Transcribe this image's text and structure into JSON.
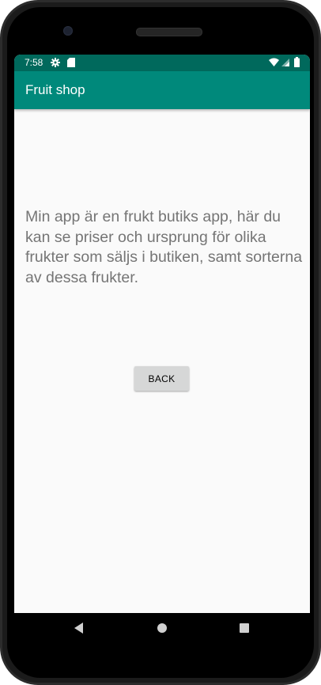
{
  "status_bar": {
    "time": "7:58",
    "icons": [
      "gear-icon",
      "sd-card-icon",
      "wifi-icon",
      "signal-icon",
      "battery-icon"
    ],
    "background": "#00695c"
  },
  "app_bar": {
    "title": "Fruit shop",
    "background": "#00897b"
  },
  "main": {
    "description": "Min app är en frukt butiks app, här du kan se priser och ursprung för olika frukter som säljs i butiken, samt sorterna av dessa frukter.",
    "back_button_label": "BACK"
  },
  "navigation_bar": {
    "icons": [
      "back-triangle-icon",
      "home-circle-icon",
      "recents-square-icon"
    ]
  }
}
